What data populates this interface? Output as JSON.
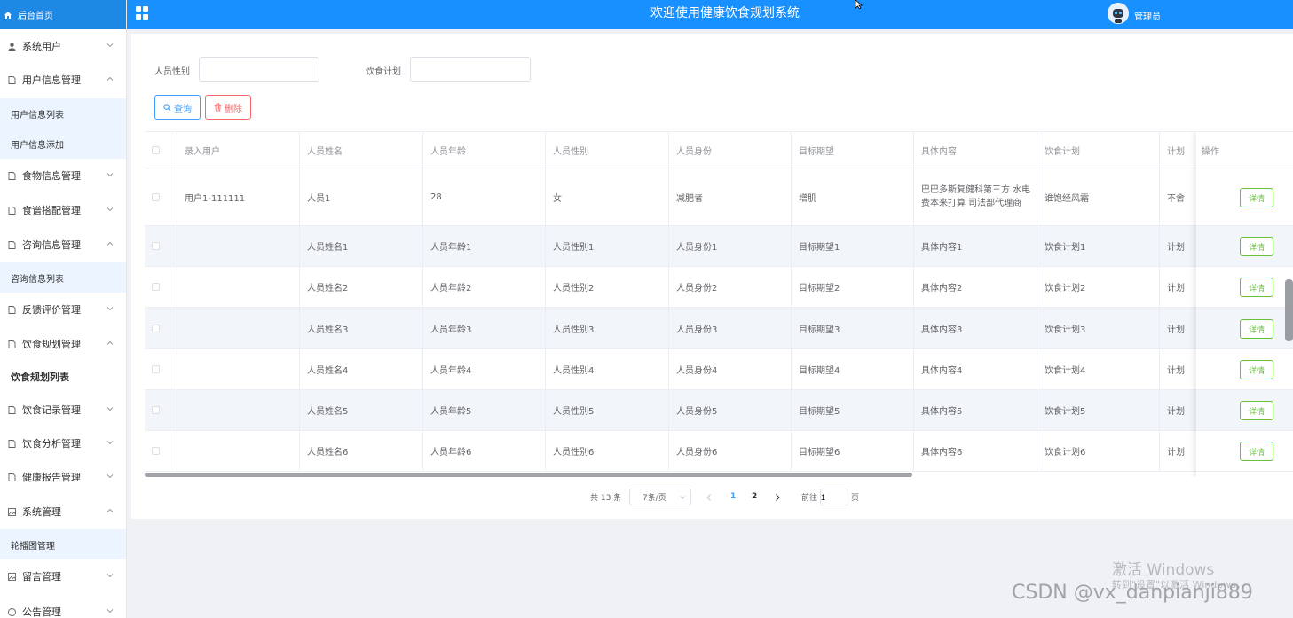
{
  "header": {
    "home_label": "后台首页",
    "title": "欢迎使用健康饮食规划系统",
    "user_name": "管理员",
    "colors": {
      "bar": "#1890ff",
      "home": "#1e88e5"
    }
  },
  "sidebar": {
    "items": [
      {
        "label": "系统用户",
        "icon": "user-icon",
        "expanded": false
      },
      {
        "label": "用户信息管理",
        "icon": "doc-icon",
        "expanded": true
      },
      {
        "label": "用户信息列表",
        "sub": true
      },
      {
        "label": "用户信息添加",
        "sub": true
      },
      {
        "label": "食物信息管理",
        "icon": "doc-icon",
        "expanded": false
      },
      {
        "label": "食谱搭配管理",
        "icon": "doc-icon",
        "expanded": false
      },
      {
        "label": "咨询信息管理",
        "icon": "doc-icon",
        "expanded": true
      },
      {
        "label": "咨询信息列表",
        "sub": true
      },
      {
        "label": "反馈评价管理",
        "icon": "doc-icon",
        "expanded": false
      },
      {
        "label": "饮食规划管理",
        "icon": "doc-icon",
        "expanded": true
      },
      {
        "label": "饮食规划列表",
        "sub": true,
        "active": true
      },
      {
        "label": "饮食记录管理",
        "icon": "doc-icon",
        "expanded": false
      },
      {
        "label": "饮食分析管理",
        "icon": "doc-icon",
        "expanded": false
      },
      {
        "label": "健康报告管理",
        "icon": "doc-icon",
        "expanded": false
      },
      {
        "label": "系统管理",
        "icon": "picture-icon",
        "expanded": true
      },
      {
        "label": "轮播图管理",
        "sub": true
      },
      {
        "label": "留言管理",
        "icon": "picture-icon",
        "expanded": false
      },
      {
        "label": "公告管理",
        "icon": "info-icon",
        "expanded": false
      }
    ]
  },
  "search": {
    "gender_label": "人员性别",
    "gender_value": "",
    "plan_label": "饮食计划",
    "plan_value": "",
    "query_label": "查询",
    "delete_label": "删除"
  },
  "table": {
    "columns": [
      "录入用户",
      "人员姓名",
      "人员年龄",
      "人员性别",
      "人员身份",
      "目标期望",
      "具体内容",
      "饮食计划",
      "计划"
    ],
    "action_header": "操作",
    "detail_label": "详情",
    "rows": [
      [
        "用户1-111111",
        "人员1",
        "28",
        "女",
        "减肥者",
        "增肌",
        "巴巴多斯复健科第三方 水电费本来打算 司法部代理商",
        "谁饱经风霜",
        "不舍"
      ],
      [
        "",
        "人员姓名1",
        "人员年龄1",
        "人员性别1",
        "人员身份1",
        "目标期望1",
        "具体内容1",
        "饮食计划1",
        "计划"
      ],
      [
        "",
        "人员姓名2",
        "人员年龄2",
        "人员性别2",
        "人员身份2",
        "目标期望2",
        "具体内容2",
        "饮食计划2",
        "计划"
      ],
      [
        "",
        "人员姓名3",
        "人员年龄3",
        "人员性别3",
        "人员身份3",
        "目标期望3",
        "具体内容3",
        "饮食计划3",
        "计划"
      ],
      [
        "",
        "人员姓名4",
        "人员年龄4",
        "人员性别4",
        "人员身份4",
        "目标期望4",
        "具体内容4",
        "饮食计划4",
        "计划"
      ],
      [
        "",
        "人员姓名5",
        "人员年龄5",
        "人员性别5",
        "人员身份5",
        "目标期望5",
        "具体内容5",
        "饮食计划5",
        "计划"
      ],
      [
        "",
        "人员姓名6",
        "人员年龄6",
        "人员性别6",
        "人员身份6",
        "目标期望6",
        "具体内容6",
        "饮食计划6",
        "计划"
      ]
    ]
  },
  "pagination": {
    "total": "共 13 条",
    "page_size": "7条/页",
    "pages": [
      "1",
      "2"
    ],
    "current_page": "1",
    "goto_label": "前往",
    "goto_value": "1",
    "page_suffix": "页"
  },
  "watermark": {
    "line1": "激活 Windows",
    "line2": "转到\"设置\"以激活 Windows。",
    "csdn": "CSDN @vx_danpianji889"
  }
}
